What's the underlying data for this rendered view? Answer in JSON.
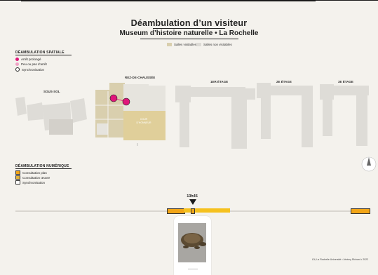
{
  "header": {
    "title": "Déambulation d’un visiteur",
    "subtitle": "Museum d’histoire naturelle • La Rochelle",
    "legend": [
      {
        "label": "Salles visitables",
        "color": "#d9cfae"
      },
      {
        "label": "Salles non visitables",
        "color": "#dcdad5"
      }
    ]
  },
  "spatial_legend": {
    "title": "DÉAMBULATION SPATIALE",
    "items": [
      {
        "label": "Arrêt prolongé",
        "color": "#e0157a"
      },
      {
        "label": "Peu ou pas d’arrêt",
        "color": "#f0a3c6"
      },
      {
        "label": "Synchronisation",
        "color": "#ffffff"
      }
    ]
  },
  "floors": {
    "sous_sol": "SOUS-SOL",
    "rez": "REZ-DE-CHAUSSÉE",
    "etage1": "1er ÉTAGE",
    "etage2": "2e ÉTAGE",
    "etage3": "3e ÉTAGE"
  },
  "rooms": {
    "rez_room": "COUR\nD’HONNEUR"
  },
  "digital_legend": {
    "title": "DÉAMBULATION NUMÉRIQUE",
    "items": [
      {
        "label": "Consultation plan",
        "color": "#f2a516"
      },
      {
        "label": "Consultation œuvre",
        "color": "#e2b23a"
      },
      {
        "label": "Synchronisation",
        "color": "#ffffff"
      }
    ]
  },
  "timeline": {
    "current_time": "13h45",
    "colors": {
      "plan": "#f2a516",
      "oeuvre": "#f5c11e",
      "track": "#d9d6d0"
    }
  },
  "footer": {
    "credits": "L3i, La Rochelle Université • Jérémy Richard • 2022"
  },
  "colors": {
    "background": "#f4f2ed",
    "accent_pink": "#e0157a",
    "accent_orange": "#f2a516"
  }
}
